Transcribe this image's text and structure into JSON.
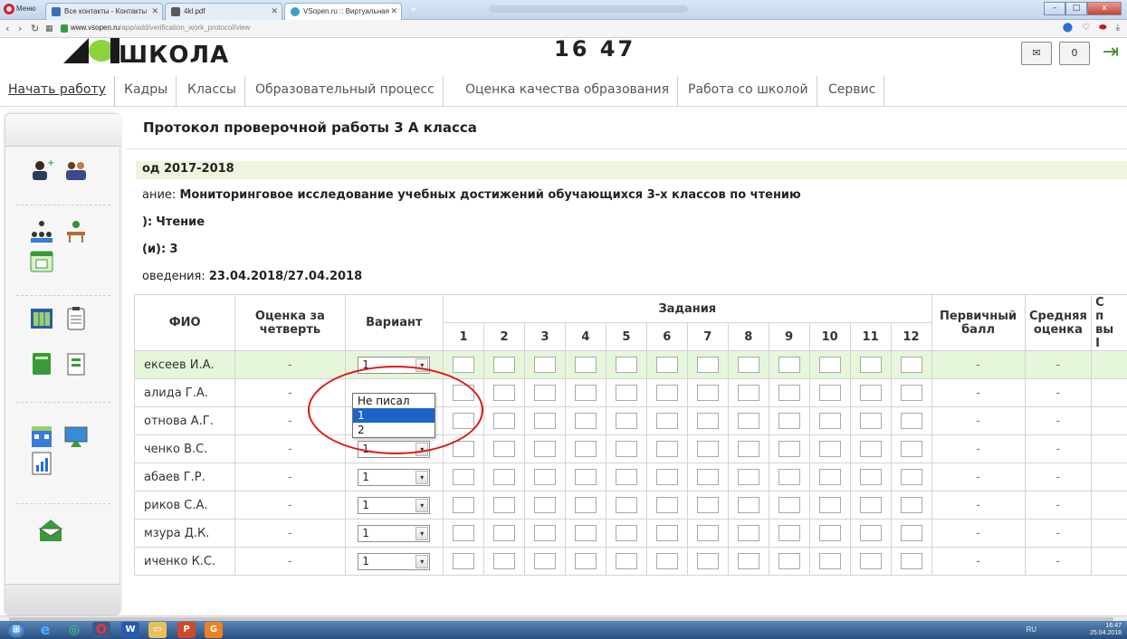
{
  "browser": {
    "menu_label": "Меню",
    "tabs": [
      {
        "label": "Все контакты - Контакты"
      },
      {
        "label": "4kl.pdf"
      },
      {
        "label": "VSopen.ru :: Виртуальная"
      }
    ],
    "new_tab_label": "+",
    "url_domain": "www.vsopen.ru",
    "url_path": "/app/add/verification_work_protocol/view",
    "minimize_label": "–",
    "maximize_label": "□",
    "close_label": "x"
  },
  "site": {
    "logo_text": "ШКОЛА",
    "clock_text": "16 47",
    "notifications_count": "0"
  },
  "nav": {
    "items": [
      "Начать работу",
      "Кадры",
      "Классы",
      "Образовательный процесс",
      "Оценка качества образования",
      "Работа со школой",
      "Сервис"
    ]
  },
  "page": {
    "title": "Протокол проверочной работы 3 А класса",
    "year_label": "од 2017-2018",
    "work_label": "ание:",
    "work_value": "Мониторинговое исследование учебных достижений обучающихся 3-х классов по чтению",
    "subject_label": "):",
    "subject_value": "Чтение",
    "grade_label": "(и):",
    "grade_value": "3",
    "date_label": "оведения:",
    "date_value": "23.04.2018/27.04.2018"
  },
  "table": {
    "headers": {
      "fio": "ФИО",
      "quarter": "Оценка за четверть",
      "variant": "Вариант",
      "tasks": "Задания",
      "primary": "Первичный балл",
      "average": "Средняя оценка",
      "extra_top": "С",
      "extra_mid": "п",
      "extra_bot": "вы",
      "extra_last": "I"
    },
    "task_numbers": [
      "1",
      "2",
      "3",
      "4",
      "5",
      "6",
      "7",
      "8",
      "9",
      "10",
      "11",
      "12"
    ],
    "rows": [
      {
        "name": "ексеев И.А.",
        "quarter": "-",
        "variant": "1",
        "primary": "-",
        "average": "-"
      },
      {
        "name": "алида Г.А.",
        "quarter": "-",
        "variant": "",
        "primary": "-",
        "average": "-"
      },
      {
        "name": "отнова А.Г.",
        "quarter": "-",
        "variant": "",
        "primary": "-",
        "average": "-"
      },
      {
        "name": "ченко В.С.",
        "quarter": "-",
        "variant": "1",
        "primary": "-",
        "average": "-"
      },
      {
        "name": "абаев Г.Р.",
        "quarter": "-",
        "variant": "1",
        "primary": "-",
        "average": "-"
      },
      {
        "name": "риков С.А.",
        "quarter": "-",
        "variant": "1",
        "primary": "-",
        "average": "-"
      },
      {
        "name": "мзура Д.К.",
        "quarter": "-",
        "variant": "1",
        "primary": "-",
        "average": "-"
      },
      {
        "name": "иченко К.С.",
        "quarter": "-",
        "variant": "1",
        "primary": "-",
        "average": "-"
      }
    ]
  },
  "dropdown": {
    "options": [
      "Не писал",
      "1",
      "2"
    ],
    "selected": "1"
  },
  "taskbar": {
    "lang": "RU",
    "time": "16:47",
    "date": "25.04.2018"
  }
}
